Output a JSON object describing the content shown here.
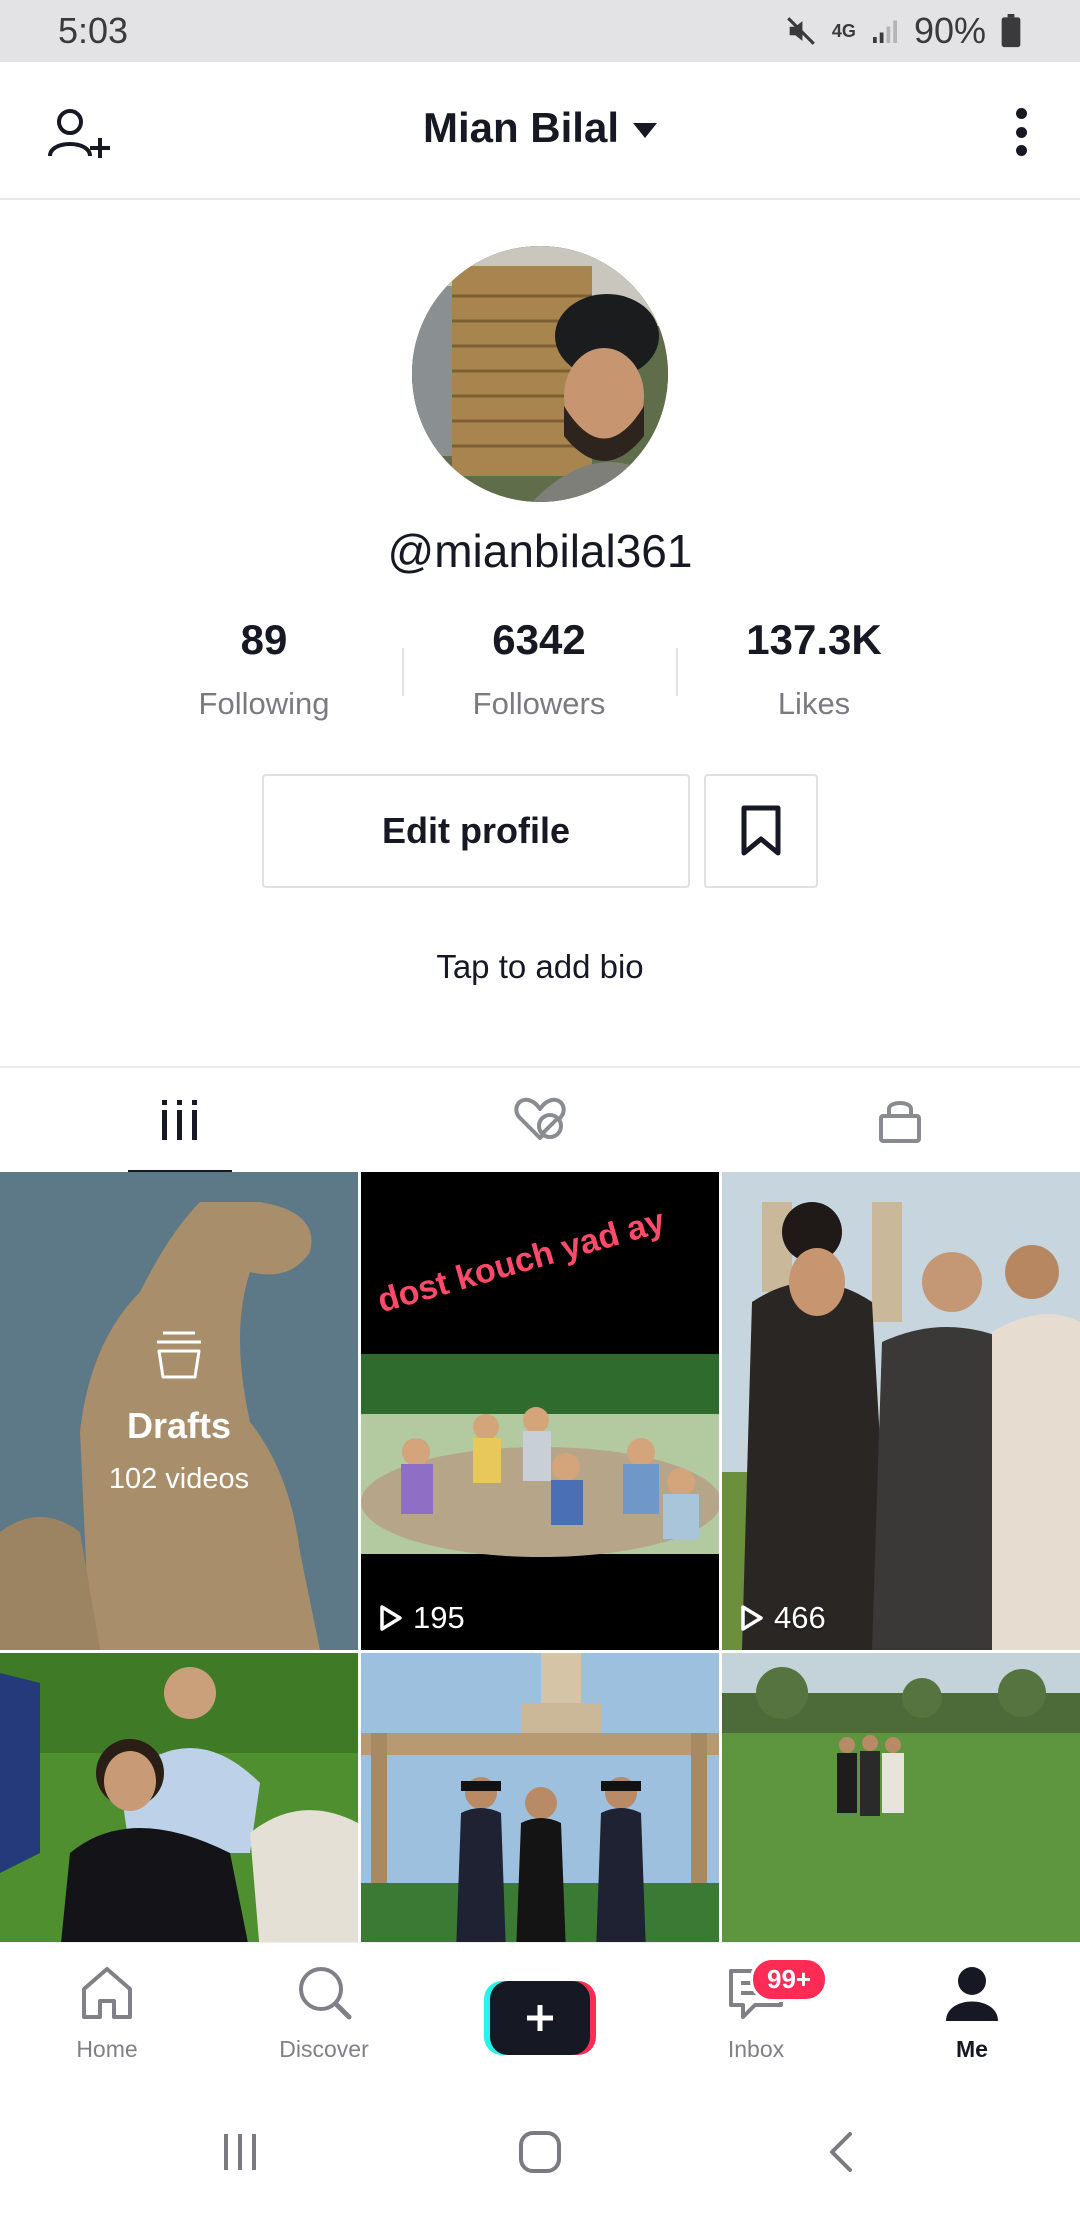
{
  "status_bar": {
    "time": "5:03",
    "network": "4G",
    "battery": "90%"
  },
  "header": {
    "title": "Mian Bilal"
  },
  "profile": {
    "username": "@mianbilal361",
    "stats": [
      {
        "value": "89",
        "label": "Following"
      },
      {
        "value": "6342",
        "label": "Followers"
      },
      {
        "value": "137.3K",
        "label": "Likes"
      }
    ],
    "edit_label": "Edit profile",
    "bio_placeholder": "Tap to add bio"
  },
  "tabs": [
    "videos-grid-icon",
    "liked-hidden-icon",
    "private-lock-icon"
  ],
  "grid": {
    "drafts_title": "Drafts",
    "drafts_count": "102 videos",
    "video_overlay_text": "dost kouch yad ay",
    "video_views": [
      "195",
      "466"
    ]
  },
  "bottom_nav": {
    "home": "Home",
    "discover": "Discover",
    "inbox": "Inbox",
    "inbox_badge": "99+",
    "me": "Me"
  },
  "colors": {
    "accent": "#fe2c55",
    "cyan": "#25f4ee",
    "text": "#161823"
  }
}
